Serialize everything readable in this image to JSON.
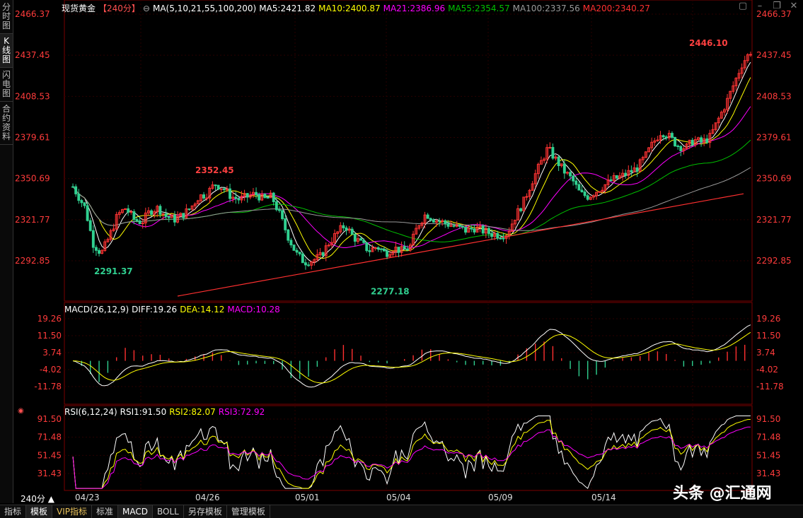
{
  "sidebar": {
    "tabs": [
      {
        "label": "分时图",
        "active": false
      },
      {
        "label": "K线图",
        "active": true
      },
      {
        "label": "闪电图",
        "active": false
      },
      {
        "label": "合约资料",
        "active": false
      }
    ]
  },
  "header": {
    "symbol": "现货黄金",
    "period": "【240分】",
    "ma_params": "MA(5,10,21,55,100,200)",
    "ma": [
      {
        "label": "MA5:2421.82",
        "color": "#ffffff"
      },
      {
        "label": "MA10:2400.87",
        "color": "#ffff00"
      },
      {
        "label": "MA21:2386.96",
        "color": "#ff00ff"
      },
      {
        "label": "MA55:2354.57",
        "color": "#00c000"
      },
      {
        "label": "MA100:2337.56",
        "color": "#9a9a9a"
      },
      {
        "label": "MA200:2340.27",
        "color": "#ff3030"
      }
    ],
    "icons": [
      "layout-icon",
      "minimize-icon",
      "restore-icon",
      "close-icon"
    ]
  },
  "price_axis": [
    "2466.37",
    "2437.45",
    "2408.53",
    "2379.61",
    "2350.69",
    "2321.77",
    "2292.85"
  ],
  "price_labels": {
    "high": "2446.10",
    "mid": "2352.45",
    "low1": "2291.37",
    "low2": "2277.18"
  },
  "macd": {
    "title": "MACD(26,12,9)",
    "diff": "DIFF:19.26",
    "dea": "DEA:14.12",
    "macd": "MACD:10.28",
    "axis": [
      "19.26",
      "11.50",
      "3.74",
      "-4.02",
      "-11.78"
    ]
  },
  "rsi": {
    "title": "RSI(6,12,24)",
    "rsi1": "RSI1:91.50",
    "rsi2": "RSI2:82.07",
    "rsi3": "RSI3:72.92",
    "axis": [
      "91.50",
      "71.48",
      "51.45",
      "31.43"
    ]
  },
  "dates": [
    "04/23",
    "04/26",
    "05/01",
    "05/04",
    "05/09",
    "05/14"
  ],
  "period_selector": "240分 ▲",
  "bottom_tabs": [
    {
      "label": "指标",
      "active": false
    },
    {
      "label": "模板",
      "active": true
    },
    {
      "label": "VIP指标",
      "active": false,
      "vip": true
    },
    {
      "label": "标准",
      "active": false
    },
    {
      "label": "MACD",
      "active": true
    },
    {
      "label": "BOLL",
      "active": false
    },
    {
      "label": "另存模板",
      "active": false
    },
    {
      "label": "管理模板",
      "active": false
    }
  ],
  "watermark": "头条 @汇通网",
  "colors": {
    "up": "#ff3333",
    "down": "#30d090",
    "axis_text": "#ff3b3b",
    "grid": "#3a0000",
    "frame": "#7a0000"
  }
}
